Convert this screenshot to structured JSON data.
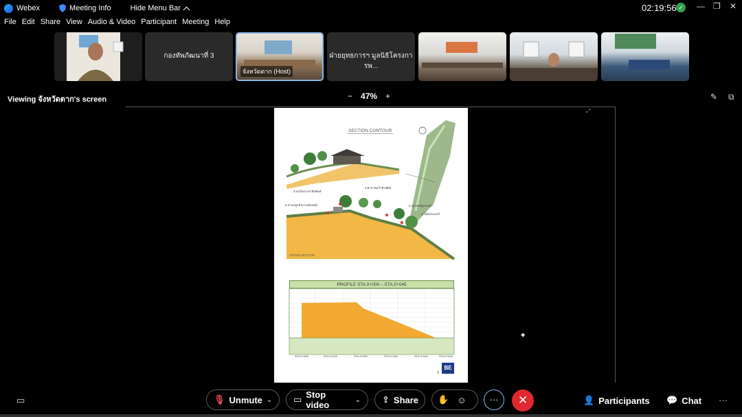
{
  "titlebar": {
    "app_name": "Webex",
    "meeting_info": "Meeting Info",
    "hide_menu_bar": "Hide Menu Bar",
    "clock": "02:19:56"
  },
  "menu": {
    "items": [
      "File",
      "Edit",
      "Share",
      "View",
      "Audio & Video",
      "Participant",
      "Meeting",
      "Help"
    ]
  },
  "participants": {
    "tile2_name": "กองทัพภัฒนาที่ 3",
    "tile3_name": "จังหวัดตาก (Host)",
    "tile4_name": "ฝ่ายยุทธการฯ มูลนิธิโครงการพ..."
  },
  "viewing": {
    "label": "Viewing จังหวัดตาก's screen",
    "zoom_minus": "−",
    "zoom_level": "47%",
    "zoom_plus": "+"
  },
  "document": {
    "section_title": "SECTION CONTOUR",
    "cross_section": "CROSS SECTION",
    "label_1": "1.ไม้ดอกแมงจี",
    "label_2": "2.เขาหงษ์ลูกชนห้า",
    "label_3": "3.บอร์ดประชาสัมพันธ์",
    "label_4": "4.ศาลาชมวิวทิวทัศน์",
    "label_5": "5.ลานปลูกต้นกาเฟลงหญ้า",
    "profile_title": "PROFILE  STA.0+000  –  STA.0+045",
    "stations": [
      "STA.0+000",
      "STA.0+010",
      "STA.0+020",
      "STA.0+030",
      "STA.0+040",
      "STA.0+045"
    ],
    "page_number": "3",
    "logo_text": "BE"
  },
  "chart_data": {
    "type": "area",
    "title": "PROFILE  STA.0+000  –  STA.0+045",
    "categories": [
      "STA.0+000",
      "STA.0+010",
      "STA.0+020",
      "STA.0+030",
      "STA.0+040",
      "STA.0+045"
    ],
    "fill_color": "#f2a833"
  },
  "controls": {
    "unmute": "Unmute",
    "stop_video": "Stop video",
    "share": "Share",
    "participants": "Participants",
    "chat": "Chat",
    "more": "···",
    "end": "✕"
  },
  "colors": {
    "accent_red": "#e0282f",
    "host_border": "#8bb8e8",
    "area_orange": "#f2a833",
    "profile_green": "#c8e0a8"
  }
}
